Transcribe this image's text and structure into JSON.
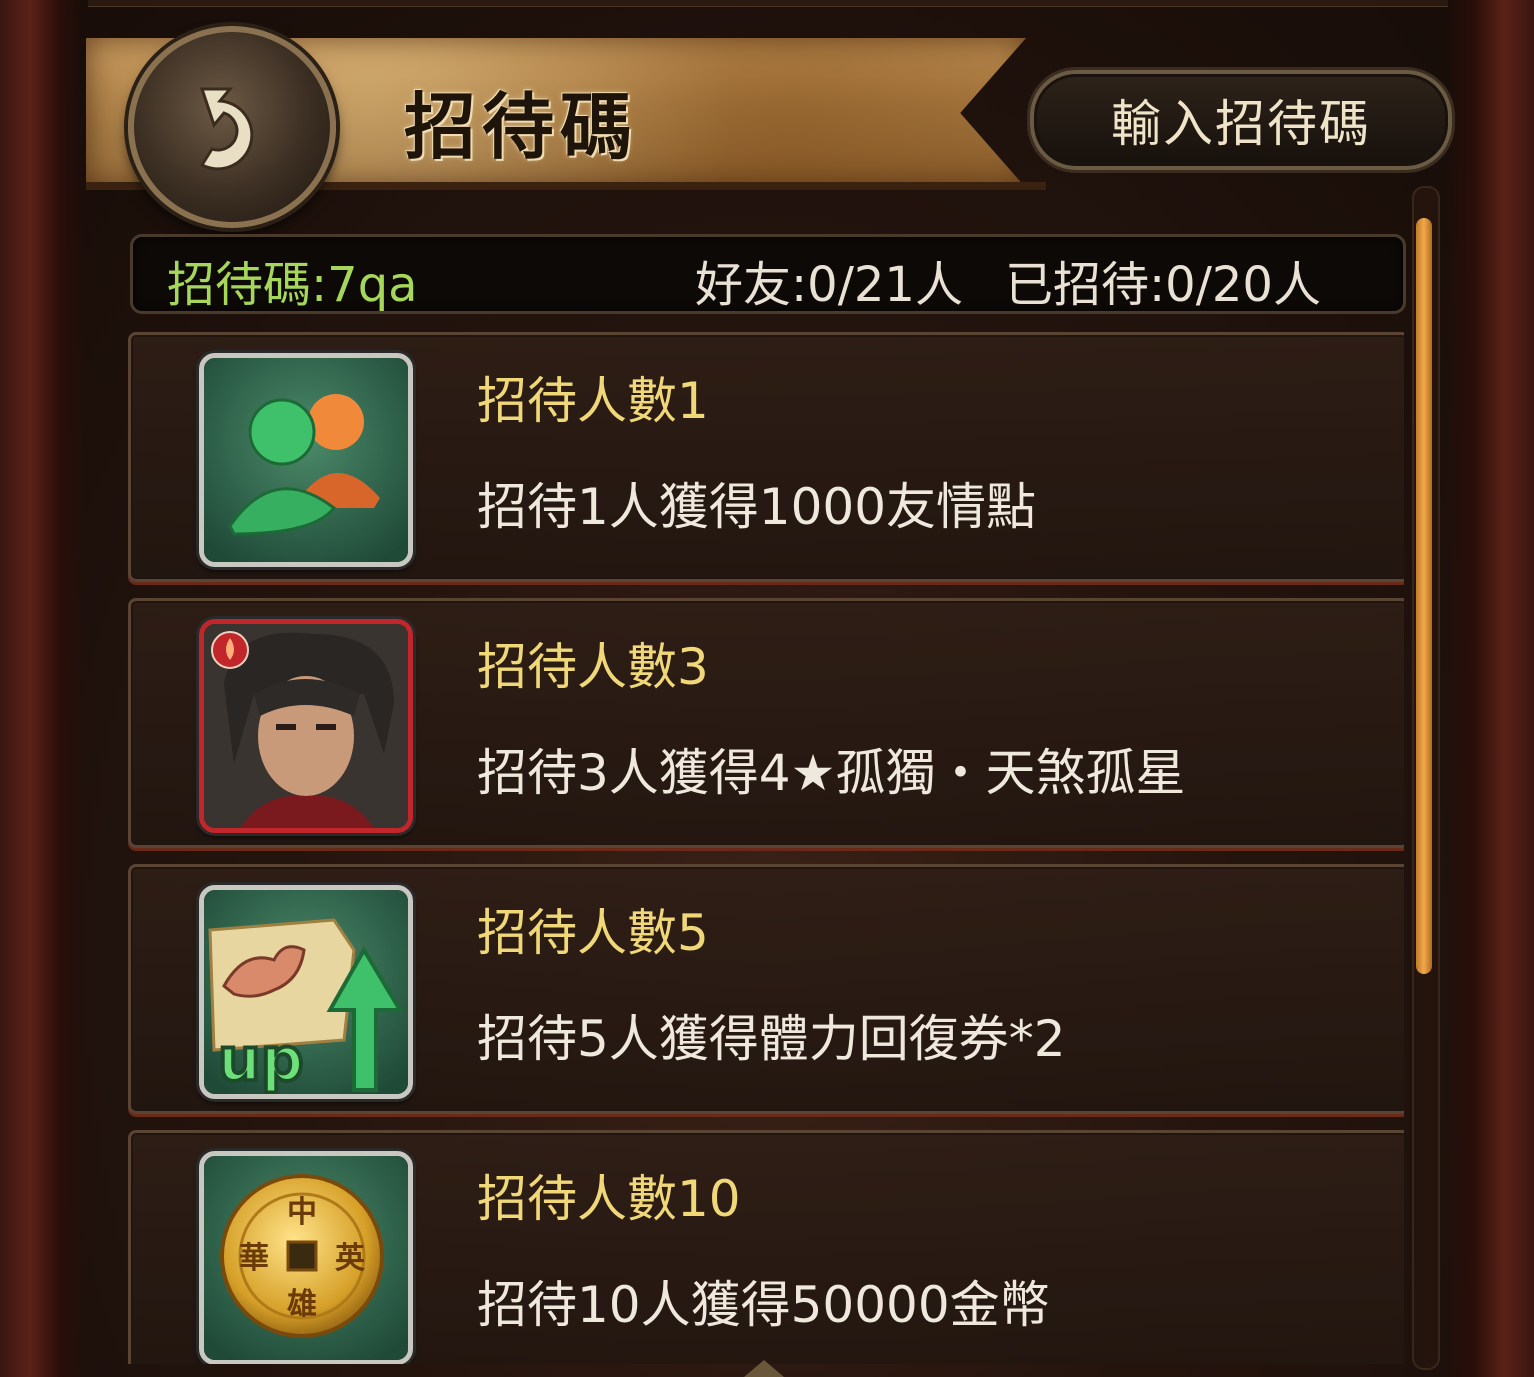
{
  "header": {
    "title": "招待碼",
    "back_icon": "back-arrow-icon",
    "enter_code_label": "輸入招待碼"
  },
  "stats": {
    "invite_code": "招待碼:7qa",
    "friends": "好友:0/21人",
    "invited": "已招待:0/20人"
  },
  "rewards": [
    {
      "title": "招待人數1",
      "description": "招待1人獲得1000友情點",
      "icon": "friends-icon"
    },
    {
      "title": "招待人數3",
      "description": "招待3人獲得4★孤獨・天煞孤星",
      "icon": "hero-portrait-icon"
    },
    {
      "title": "招待人數5",
      "description": "招待5人獲得體力回復券*2",
      "icon": "stamina-up-icon"
    },
    {
      "title": "招待人數10",
      "description": "招待10人獲得50000金幣",
      "icon": "gold-coin-icon",
      "coin_text": [
        "中",
        "華",
        "英",
        "雄"
      ]
    }
  ],
  "colors": {
    "title_gold": "#f0d878",
    "code_green": "#a6d65a",
    "scroll_orange": "#f0a84a"
  }
}
